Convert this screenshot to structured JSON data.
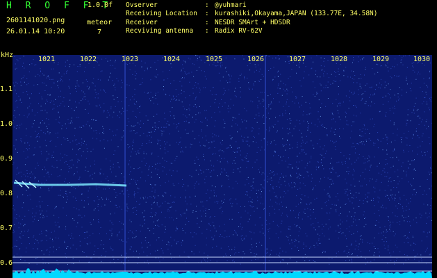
{
  "header": {
    "logo": "H R O F F T",
    "version": "1.0.0f",
    "filename": "2601141020.png",
    "datetime": "26.01.14  10:20",
    "meteor_label": "meteor",
    "meteor_count": "7"
  },
  "info": [
    {
      "key": "Ovserver",
      "value": "@yuhmari"
    },
    {
      "key": "Receiving Location",
      "value": "kurashiki,Okayama,JAPAN (133.77E, 34.58N)"
    },
    {
      "key": "Receiver",
      "value": "NESDR SMArt + HDSDR"
    },
    {
      "key": "Recviving antenna",
      "value": "Radix RV-62V"
    }
  ],
  "axis": {
    "y_unit": "kHz",
    "y_ticks": [
      "1.1",
      "1.0",
      "0.9",
      "0.8",
      "0.7",
      "0.6"
    ],
    "x_ticks": [
      "1021",
      "1022",
      "1023",
      "1024",
      "1025",
      "1026",
      "1027",
      "1028",
      "1029",
      "1030"
    ]
  },
  "colors": {
    "background": "#0c1a6e",
    "label": "#ffff66",
    "logo": "#33ff33",
    "trace": "#00ffff"
  }
}
